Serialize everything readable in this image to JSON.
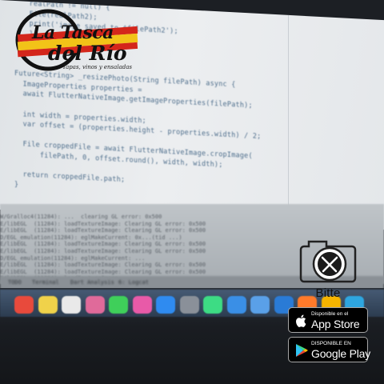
{
  "editor": {
    "lines": [
      "  realPath != null) {",
      "  File(realPath2);",
      "  print('image saved to $filePath2');",
      "  }",
      "  });",
      "}",
      "",
      "Future<String> _resizePhoto(String filePath) async {",
      "  ImageProperties properties =",
      "  await FlutterNativeImage.getImageProperties(filePath);",
      "",
      "  int width = properties.width;",
      "  var offset = (properties.height - properties.width) / 2;",
      "",
      "  File croppedFile = await FlutterNativeImage.cropImage(",
      "      filePath, 0, offset.round(), width, width);",
      "",
      "  return croppedFile.path;",
      "}"
    ]
  },
  "console": {
    "lines": [
      "W/Gralloc4(11284): ...  clearing GL error: 0x500",
      "E/libEGL  (11284): loadTextureImage: Clearing GL error: 0x500",
      "E/libEGL  (11284): loadTextureImage: Clearing GL error: 0x500",
      "D/EGL_emulation(11284): eglMakeCurrent: 0x...(tid ...)",
      "E/libEGL  (11284): loadTextureImage: Clearing GL error: 0x500",
      "E/libEGL  (11284): loadTextureImage: Clearing GL error: 0x500",
      "D/EGL_emulation(11284): eglMakeCurrent: ...",
      "E/libEGL  (11284): loadTextureImage: Clearing GL error: 0x500",
      "E/libEGL  (11284): loadTextureImage: Clearing GL error: 0x500",
      "E/libEGL  (11284): loadTextureImage: ..."
    ],
    "status_items": [
      "TODO",
      "Terminal",
      "Dart Analysis",
      "6: Logcat"
    ]
  },
  "logo": {
    "title": "La Tasca",
    "subtitle": "del Río",
    "tagline": "Tapas, vinos y ensaladas",
    "colors": {
      "red": "#d4261b",
      "yellow": "#f2c318",
      "ink": "#111111"
    }
  },
  "bitte": {
    "label": "Bitte",
    "icon": "camera-fork-knife-icon"
  },
  "badges": {
    "app_store": {
      "small": "Disponible en el",
      "big": "App Store",
      "icon": "apple-icon"
    },
    "google_play": {
      "small": "DISPONIBLE EN",
      "big": "Google Play",
      "icon": "google-play-icon"
    }
  },
  "dock": {
    "icons": [
      {
        "name": "calendar-icon",
        "color": "#e84a3c"
      },
      {
        "name": "notes-icon",
        "color": "#f0d24a"
      },
      {
        "name": "reminders-icon",
        "color": "#e9e9e9"
      },
      {
        "name": "photos-icon",
        "color": "#e06a9a"
      },
      {
        "name": "messages-icon",
        "color": "#3fcf5a"
      },
      {
        "name": "itunes-icon",
        "color": "#e85aa8"
      },
      {
        "name": "app-store-icon",
        "color": "#2f8bf0"
      },
      {
        "name": "system-preferences-icon",
        "color": "#8a9099"
      },
      {
        "name": "android-studio-icon",
        "color": "#3ddc84"
      },
      {
        "name": "xcode-icon",
        "color": "#3a8fe6"
      },
      {
        "name": "finder-icon",
        "color": "#5aa0e8"
      },
      {
        "name": "vscode-icon",
        "color": "#2a7bd6"
      },
      {
        "name": "firefox-icon",
        "color": "#ff7a2a"
      },
      {
        "name": "sketch-icon",
        "color": "#f5b400"
      },
      {
        "name": "telegram-icon",
        "color": "#2ea6e0"
      }
    ]
  }
}
